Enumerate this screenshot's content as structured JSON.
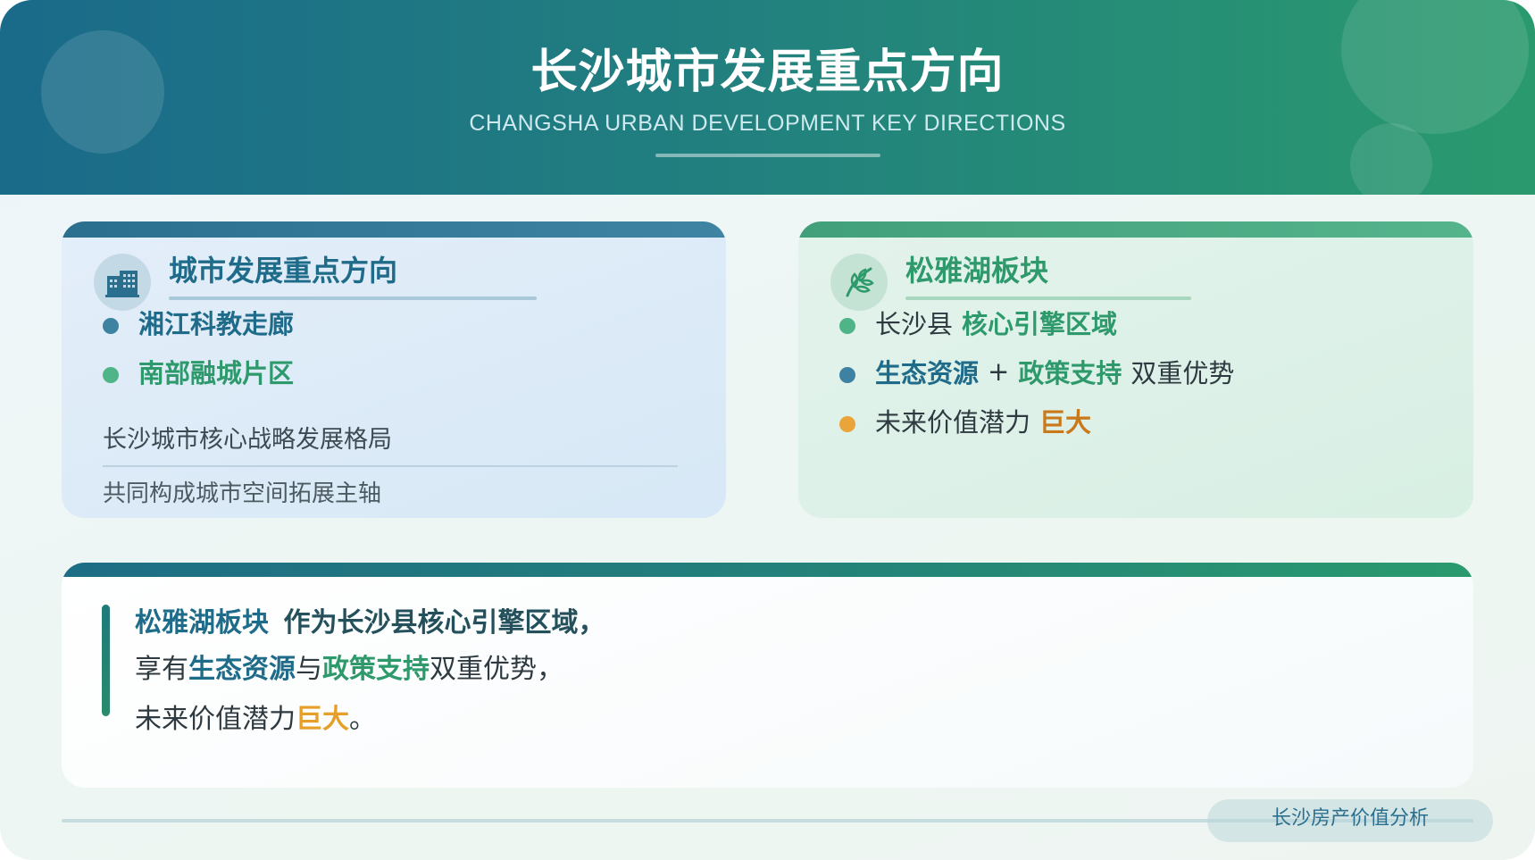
{
  "header": {
    "title": "长沙城市发展重点方向",
    "subtitle": "CHANGSHA URBAN DEVELOPMENT KEY DIRECTIONS"
  },
  "left_card": {
    "icon": "building-icon",
    "heading": "城市发展重点方向",
    "items": [
      "湘江科教走廊",
      "南部融城片区"
    ],
    "note1": "长沙城市核心战略发展格局",
    "note2": "共同构成城市空间拓展主轴"
  },
  "right_card": {
    "icon": "leaf-icon",
    "heading": "松雅湖板块",
    "items": [
      {
        "pre": "长沙县",
        "emphasis": "核心引擎区域"
      },
      {
        "em1": "生态资源",
        "plus": "+",
        "em2": "政策支持",
        "post": "双重优势"
      },
      {
        "pre": "未来价值潜力",
        "emphasis": "巨大"
      }
    ]
  },
  "summary": {
    "line1_a": "松雅湖板块",
    "line1_b": "作为长沙县核心引擎区域，",
    "line2_pre": "享有",
    "line2_em1": "生态资源",
    "line2_mid": "与",
    "line2_em2": "政策支持",
    "line2_post": "双重优势，",
    "line3_pre": "未来价值潜力",
    "line3_em": "巨大",
    "line3_post": "。"
  },
  "footer": {
    "label": "长沙房产价值分析"
  },
  "colors": {
    "primary_blue": "#1f6b8a",
    "primary_green": "#2e9a6c",
    "accent_orange": "#e6a02a"
  }
}
